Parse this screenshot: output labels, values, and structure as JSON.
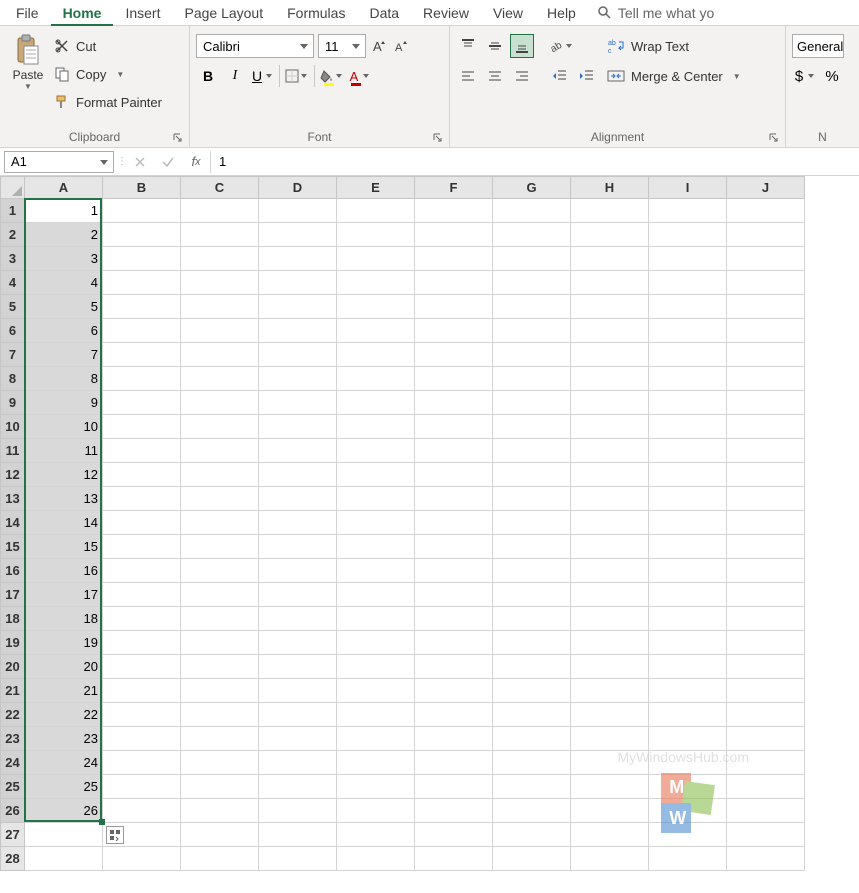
{
  "tabs": [
    "File",
    "Home",
    "Insert",
    "Page Layout",
    "Formulas",
    "Data",
    "Review",
    "View",
    "Help"
  ],
  "active_tab": "Home",
  "tellme": "Tell me what yo",
  "clipboard": {
    "paste": "Paste",
    "cut": "Cut",
    "copy": "Copy",
    "format_painter": "Format Painter",
    "label": "Clipboard"
  },
  "font": {
    "name": "Calibri",
    "size": "11",
    "label": "Font"
  },
  "alignment": {
    "wrap": "Wrap Text",
    "merge": "Merge & Center",
    "label": "Alignment"
  },
  "number": {
    "format": "General",
    "label": "N"
  },
  "namebox": "A1",
  "formula": "1",
  "columns": [
    "A",
    "B",
    "C",
    "D",
    "E",
    "F",
    "G",
    "H",
    "I",
    "J"
  ],
  "rows": [
    1,
    2,
    3,
    4,
    5,
    6,
    7,
    8,
    9,
    10,
    11,
    12,
    13,
    14,
    15,
    16,
    17,
    18,
    19,
    20,
    21,
    22,
    23,
    24,
    25,
    26,
    27,
    28
  ],
  "col_a_values": [
    1,
    2,
    3,
    4,
    5,
    6,
    7,
    8,
    9,
    10,
    11,
    12,
    13,
    14,
    15,
    16,
    17,
    18,
    19,
    20,
    21,
    22,
    23,
    24,
    25,
    26
  ],
  "selection": {
    "col": "A",
    "row_start": 1,
    "row_end": 26,
    "active_row": 1
  },
  "watermark": "MyWindowsHub.com"
}
